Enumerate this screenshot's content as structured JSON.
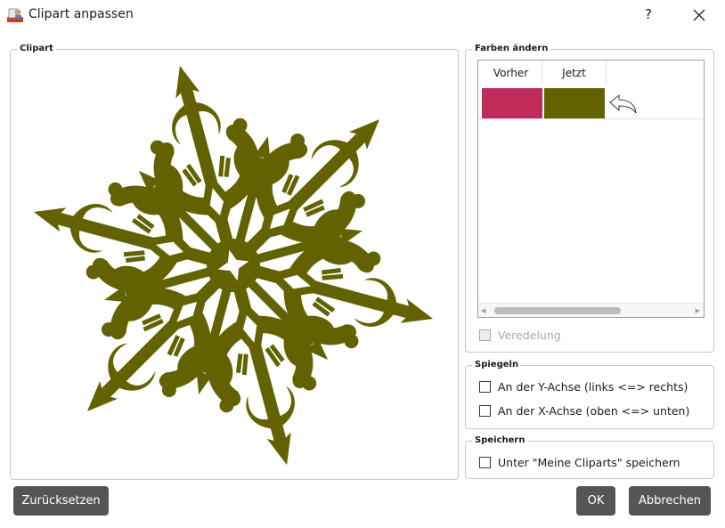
{
  "window": {
    "title": "Clipart anpassen",
    "help_label": "?",
    "icon": "app-clipart-icon"
  },
  "clipart_group": {
    "legend": "Clipart",
    "preview_icon": "snowflake-clipart"
  },
  "colors_group": {
    "legend": "Farben ändern",
    "headers": {
      "before": "Vorher",
      "now": "Jetzt"
    },
    "rows": [
      {
        "before_color": "#c02b5a",
        "now_color": "#626200"
      }
    ],
    "undo_icon": "undo-arrow-icon",
    "finishing_label": "Veredelung",
    "finishing_checked": false,
    "finishing_enabled": false
  },
  "mirror_group": {
    "legend": "Spiegeln",
    "y_axis_label": "An der Y-Achse (links <=> rechts)",
    "x_axis_label": "An der X-Achse (oben <=> unten)",
    "y_checked": false,
    "x_checked": false
  },
  "save_group": {
    "legend": "Speichern",
    "save_label": "Unter \"Meine Cliparts\" speichern",
    "save_checked": false
  },
  "buttons": {
    "reset": "Zurücksetzen",
    "ok": "OK",
    "cancel": "Abbrechen"
  },
  "colors": {
    "button_bg": "#555555",
    "clipart_color": "#626200"
  }
}
